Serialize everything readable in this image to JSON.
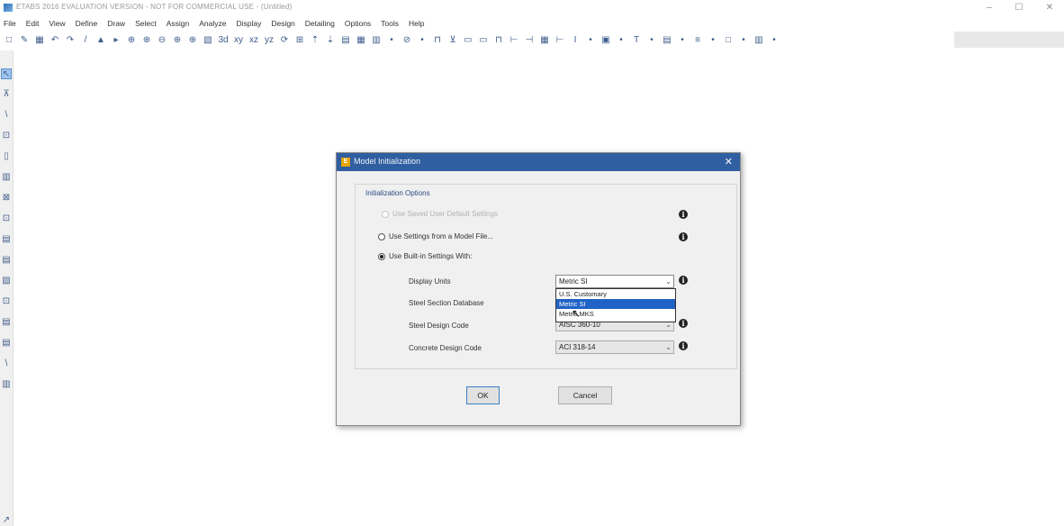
{
  "window": {
    "title": "ETABS 2016 EVALUATION VERSION - NOT FOR COMMERCIAL USE - (Untitled)",
    "controls": [
      "–",
      "☐",
      "✕"
    ]
  },
  "menu": [
    "File",
    "Edit",
    "View",
    "Define",
    "Draw",
    "Select",
    "Assign",
    "Analyze",
    "Display",
    "Design",
    "Detailing",
    "Options",
    "Tools",
    "Help"
  ],
  "toolbar_icons": [
    "□",
    "✎",
    "▦",
    "↶",
    "↷",
    "/",
    "▲",
    "▸",
    "⊕",
    "⊕",
    "⊖",
    "⊕",
    "⊕",
    "▧",
    "3d",
    "xy",
    "xz",
    "yz",
    "⟳",
    "⊞",
    "⇡",
    "⇣",
    "▤",
    "▦",
    "▥",
    "•",
    "⊘",
    "•",
    "⊓",
    "⊻",
    "▭",
    "▭",
    "⊓",
    "⊢",
    "⊣",
    "▦",
    "⊢",
    "I",
    "•",
    "▣",
    "•",
    "T",
    "•",
    "▤",
    "•",
    "≡",
    "•",
    "□",
    "•",
    "▥",
    "•"
  ],
  "left_toolbar_icons": [
    "↖",
    "⊼",
    "\\",
    "⊡",
    "▯",
    "▥",
    "⊠",
    "⊡",
    "▤",
    "▤",
    "▧",
    "⊡",
    "▤",
    "▤",
    "\\",
    "▥",
    "↗"
  ],
  "dialog": {
    "title": "Model Initialization",
    "icon_label": "E",
    "close": "✕",
    "group_title": "Initialization Options",
    "option_default": "Use Saved User Default Settings",
    "option_model_file": "Use Settings from a Model File...",
    "option_builtin": "Use Built-in Settings With:",
    "display_units_label": "Display Units",
    "display_units_value": "Metric SI",
    "steel_db_label": "Steel Section Database",
    "steel_code_label": "Steel Design Code",
    "steel_code_value": "AISC 360-10",
    "concrete_code_label": "Concrete Design Code",
    "concrete_code_value": "ACI 318-14",
    "dropdown_options": [
      "U.S. Customary",
      "Metric SI",
      "Metric MKS"
    ],
    "ok": "OK",
    "cancel": "Cancel"
  }
}
